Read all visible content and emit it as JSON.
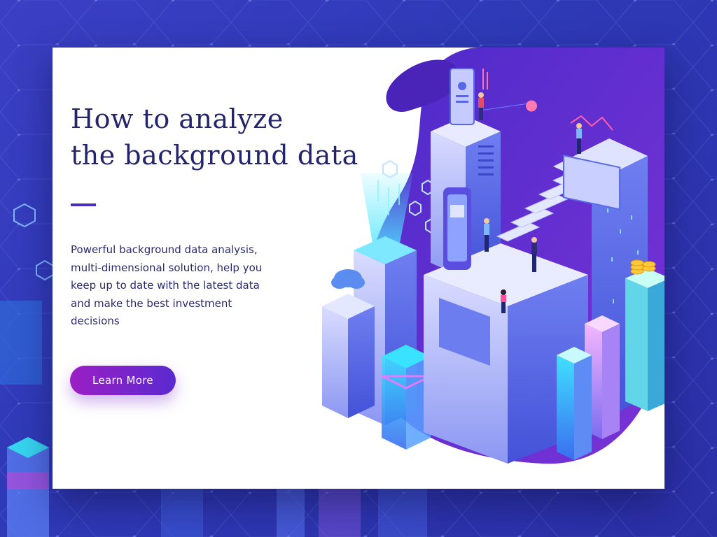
{
  "hero": {
    "title_line1": "How to analyze",
    "title_line2": "the background data",
    "description": "Powerful background data analysis, multi-dimensional solution, help you keep up to date with the latest data and make the best investment decisions",
    "cta_label": "Learn More"
  },
  "colors": {
    "background": "#3b3fc4",
    "title": "#23246b",
    "accent": "#4a2ec0",
    "button_start": "#9b1fc4",
    "button_end": "#5a2ad0"
  },
  "icons": [
    "cloud-icon",
    "profile-card-icon",
    "phone-icon",
    "chart-panel-icon",
    "coin-stack-icon",
    "data-cube-icon"
  ]
}
